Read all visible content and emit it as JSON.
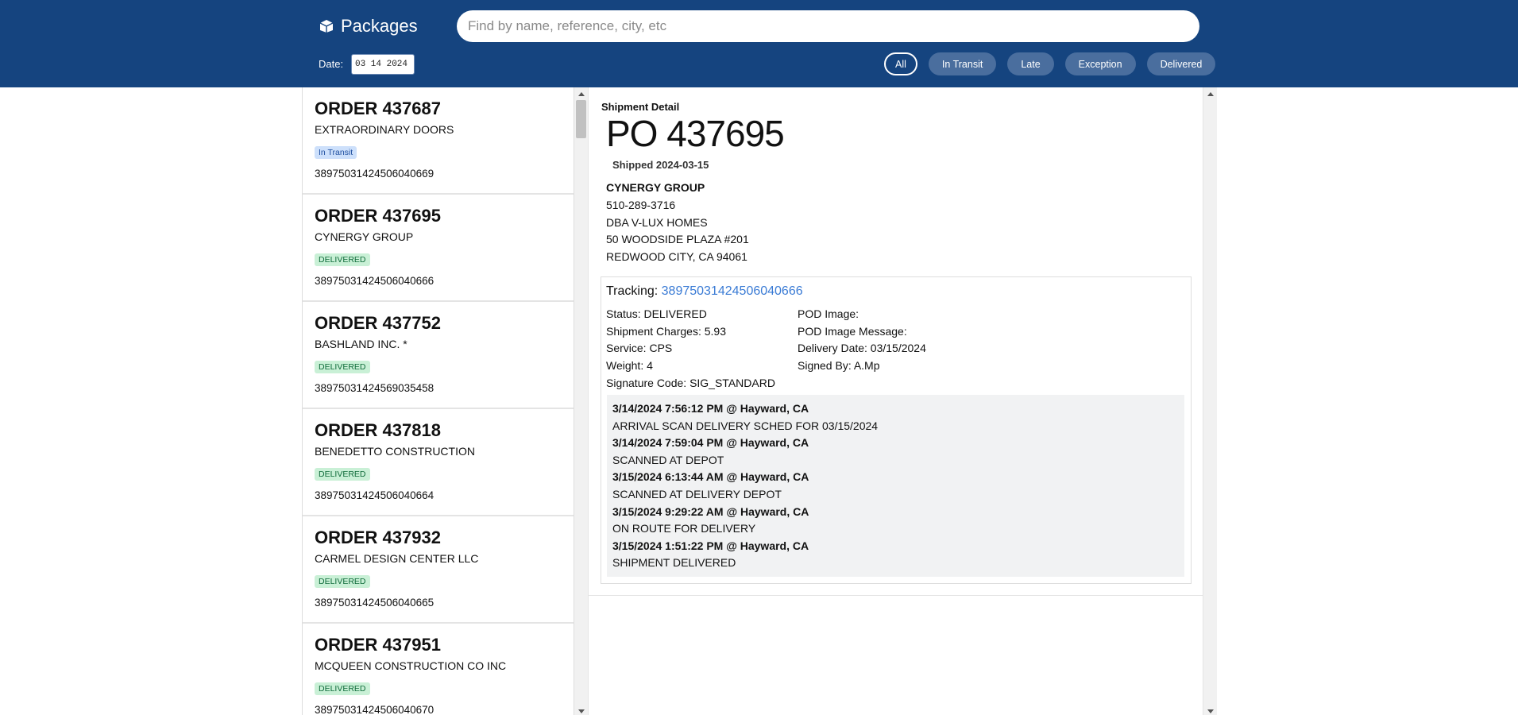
{
  "header": {
    "title": "Packages",
    "search_placeholder": "Find by name, reference, city, etc",
    "date_label": "Date:",
    "date_value": "03 14 2024",
    "filters": [
      "All",
      "In Transit",
      "Late",
      "Exception",
      "Delivered"
    ],
    "active_filter": "All"
  },
  "orders": [
    {
      "title": "ORDER 437687",
      "company": "EXTRAORDINARY DOORS",
      "status": "In Transit",
      "tracking": "38975031424506040669"
    },
    {
      "title": "ORDER 437695",
      "company": "CYNERGY GROUP",
      "status": "DELIVERED",
      "tracking": "38975031424506040666"
    },
    {
      "title": "ORDER 437752",
      "company": "BASHLAND INC. *",
      "status": "DELIVERED",
      "tracking": "38975031424569035458"
    },
    {
      "title": "ORDER 437818",
      "company": "BENEDETTO CONSTRUCTION",
      "status": "DELIVERED",
      "tracking": "38975031424506040664"
    },
    {
      "title": "ORDER 437932",
      "company": "CARMEL DESIGN CENTER LLC",
      "status": "DELIVERED",
      "tracking": "38975031424506040665"
    },
    {
      "title": "ORDER 437951",
      "company": "MCQUEEN CONSTRUCTION CO INC",
      "status": "DELIVERED",
      "tracking": "38975031424506040670"
    }
  ],
  "detail": {
    "section_title": "Shipment Detail",
    "po": "PO 437695",
    "shipped": "Shipped 2024-03-15",
    "name": "CYNERGY GROUP",
    "phone": "510-289-3716",
    "dba": "DBA V-LUX HOMES",
    "address1": "50 WOODSIDE PLAZA #201",
    "address2": "REDWOOD CITY, CA 94061",
    "tracking_label": "Tracking:",
    "tracking_number": "38975031424506040666",
    "status": "Status: DELIVERED",
    "charges": "Shipment Charges: 5.93",
    "service": "Service: CPS",
    "weight": "Weight: 4",
    "signature_code": "Signature Code: SIG_STANDARD",
    "pod_image": "POD Image:",
    "pod_message": "POD Image Message:",
    "delivery_date": "Delivery Date: 03/15/2024",
    "signed_by": "Signed By: A.Mp",
    "events": [
      {
        "when": "3/14/2024 7:56:12 PM @ Hayward, CA",
        "what": "ARRIVAL SCAN DELIVERY SCHED FOR 03/15/2024"
      },
      {
        "when": "3/14/2024 7:59:04 PM @ Hayward, CA",
        "what": "SCANNED AT DEPOT"
      },
      {
        "when": "3/15/2024 6:13:44 AM @ Hayward, CA",
        "what": "SCANNED AT DELIVERY DEPOT"
      },
      {
        "when": "3/15/2024 9:29:22 AM @ Hayward, CA",
        "what": "ON ROUTE FOR DELIVERY"
      },
      {
        "when": "3/15/2024 1:51:22 PM @ Hayward, CA",
        "what": "SHIPMENT DELIVERED"
      }
    ]
  },
  "colors": {
    "header_bg": "#15447f",
    "filter_bg": "#4a6e9e",
    "link": "#3a7bd5",
    "transit_badge": "#cde0fb",
    "delivered_badge": "#c9f0d6"
  }
}
